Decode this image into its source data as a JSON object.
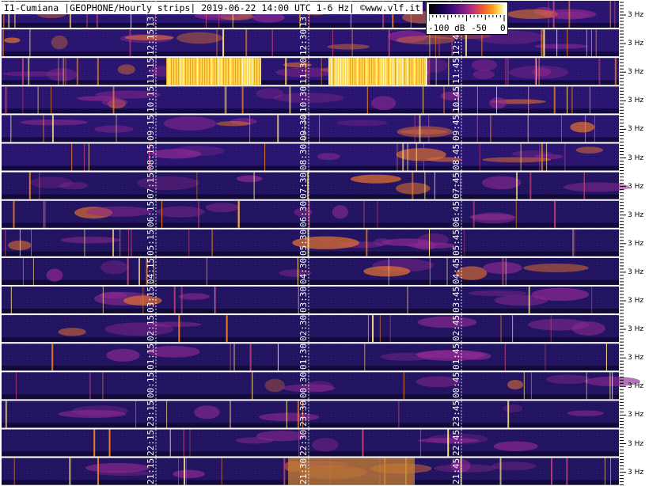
{
  "header": {
    "title": "I1-Cumiana |GEOPHONE/Hourly strips| 2019-06-22 14:00 UTC 1-6 Hz| ©www.vlf.it"
  },
  "scale": {
    "min_label": "-100 dB",
    "mid_label": "-50",
    "max_label": "0"
  },
  "hz_label": "3 Hz",
  "strips": [
    {
      "labels": [
        "13:15",
        "13:30",
        ""
      ]
    },
    {
      "labels": [
        "12:15",
        "12:30",
        "12:45"
      ]
    },
    {
      "labels": [
        "11:15",
        "11:30",
        "11:45"
      ]
    },
    {
      "labels": [
        "10:15",
        "10:30",
        "10:45"
      ]
    },
    {
      "labels": [
        "09:15",
        "09:30",
        "09:45"
      ]
    },
    {
      "labels": [
        "08:15",
        "08:30",
        "08:45"
      ]
    },
    {
      "labels": [
        "07:15",
        "07:30",
        "07:45"
      ]
    },
    {
      "labels": [
        "06:15",
        "06:30",
        "06:45"
      ]
    },
    {
      "labels": [
        "05:15",
        "05:30",
        "05:45"
      ]
    },
    {
      "labels": [
        "04:15",
        "04:30",
        "04:45"
      ]
    },
    {
      "labels": [
        "03:15",
        "03:30",
        "03:45"
      ]
    },
    {
      "labels": [
        "02:15",
        "02:30",
        "02:45"
      ]
    },
    {
      "labels": [
        "01:15",
        "01:30",
        "01:45"
      ]
    },
    {
      "labels": [
        "00:15",
        "00:30",
        "00:45"
      ]
    },
    {
      "labels": [
        "23:15",
        "23:30",
        "23:45"
      ]
    },
    {
      "labels": [
        "22:15",
        "22:30",
        "22:45"
      ]
    },
    {
      "labels": [
        "21:15",
        "21:30",
        "21:45"
      ]
    }
  ]
}
